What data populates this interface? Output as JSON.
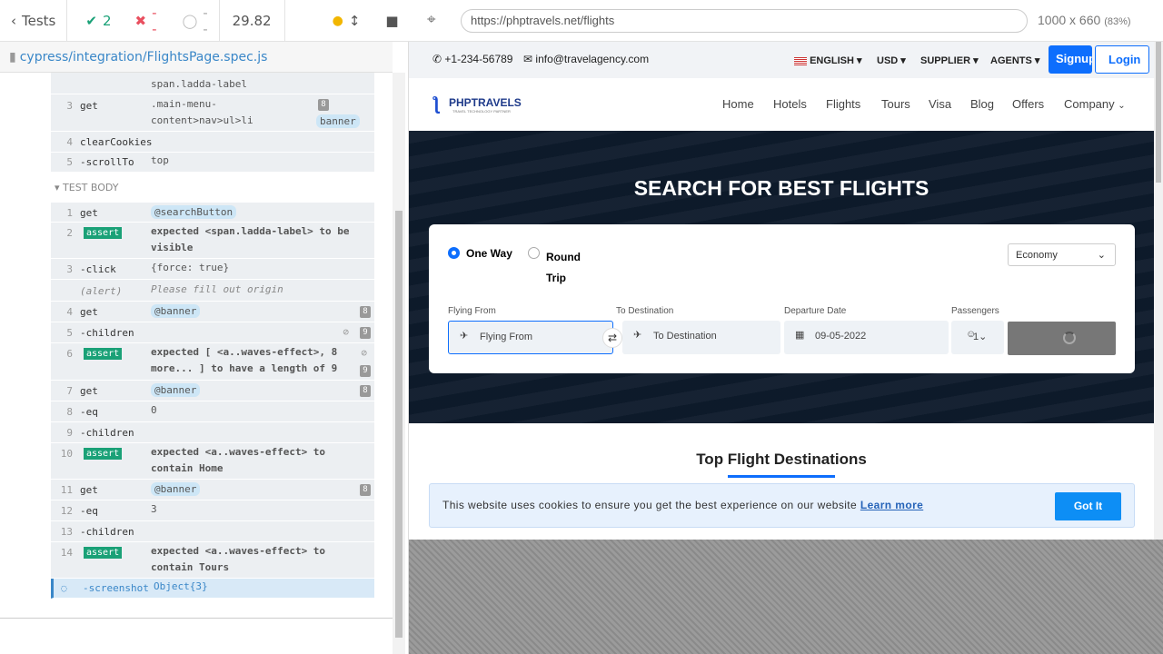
{
  "reporter": {
    "tests_label": "Tests",
    "passed": "2",
    "failed": "--",
    "pending": "--",
    "duration": "29.82",
    "spec_path": "cypress/integration/FlightsPage.spec.js",
    "test_body_label": "TEST BODY"
  },
  "commands_before": [
    {
      "num": "",
      "name": "",
      "msg": "span.ladda-label",
      "badge": "",
      "alias": ""
    },
    {
      "num": "3",
      "name": "get",
      "msg": ".main-menu-\ncontent>nav>ul>li",
      "badge": "8",
      "alias": "banner"
    },
    {
      "num": "4",
      "name": "clearCookies",
      "msg": "",
      "badge": "",
      "alias": ""
    },
    {
      "num": "5",
      "name": "-scrollTo",
      "msg": "top",
      "badge": "",
      "alias": ""
    }
  ],
  "commands": [
    {
      "num": "1",
      "name": "get",
      "msg": "",
      "alias": "@searchButton",
      "badge": ""
    },
    {
      "num": "2",
      "name": "-assert",
      "msg": "expected <span.ladda-label> to be\nvisible",
      "badge": ""
    },
    {
      "num": "3",
      "name": "-click",
      "msg": "{force: true}",
      "badge": ""
    },
    {
      "num": "",
      "name": "(alert)",
      "msg": "Please fill out origin",
      "badge": ""
    },
    {
      "num": "4",
      "name": "get",
      "msg": "",
      "alias": "@banner",
      "badge": "8"
    },
    {
      "num": "5",
      "name": "-children",
      "msg": "",
      "badge": "9"
    },
    {
      "num": "6",
      "name": "-assert",
      "msg": "expected [ <a..waves-effect>, 8\nmore... ] to have a length of 9",
      "badge": "9"
    },
    {
      "num": "7",
      "name": "get",
      "msg": "",
      "alias": "@banner",
      "badge": "8"
    },
    {
      "num": "8",
      "name": "-eq",
      "msg": "0",
      "badge": ""
    },
    {
      "num": "9",
      "name": "-children",
      "msg": "",
      "badge": ""
    },
    {
      "num": "10",
      "name": "-assert",
      "msg": "expected <a..waves-effect> to\ncontain Home",
      "badge": ""
    },
    {
      "num": "11",
      "name": "get",
      "msg": "",
      "alias": "@banner",
      "badge": "8"
    },
    {
      "num": "12",
      "name": "-eq",
      "msg": "3",
      "badge": ""
    },
    {
      "num": "13",
      "name": "-children",
      "msg": "",
      "badge": ""
    },
    {
      "num": "14",
      "name": "-assert",
      "msg": "expected <a..waves-effect> to\ncontain Tours",
      "badge": ""
    },
    {
      "num": "",
      "name": "-screenshot",
      "msg": "Object{3}",
      "badge": ""
    }
  ],
  "aut": {
    "url": "https://phptravels.net/flights",
    "viewport": "1000 x 660",
    "scale": "(83%)"
  },
  "site": {
    "phone": "+1-234-56789",
    "email": "info@travelagency.com",
    "top_menu": [
      "ENGLISH",
      "USD",
      "SUPPLIER",
      "AGENTS"
    ],
    "signup": "Signup",
    "login": "Login",
    "logo": "PHPTRAVELS",
    "logo_tag": "TRAVEL TECHNOLOGY PARTNER",
    "nav": [
      "Home",
      "Hotels",
      "Flights",
      "Tours",
      "Visa",
      "Blog",
      "Offers",
      "Company"
    ],
    "hero_title": "SEARCH FOR BEST FLIGHTS",
    "one_way": "One Way",
    "round_trip": "Round\nTrip",
    "cabin": "Economy",
    "labels": {
      "from": "Flying From",
      "to": "To Destination",
      "date": "Departure Date",
      "pax": "Passengers"
    },
    "from_placeholder": "Flying From",
    "to_placeholder": "To Destination",
    "date_value": "09-05-2022",
    "pax_value": "1",
    "top_dest": "Top Flight Destinations",
    "cookie_text": "This website uses cookies to ensure you get the best experience on our website",
    "cookie_link": "Learn more",
    "got_it": "Got It"
  }
}
